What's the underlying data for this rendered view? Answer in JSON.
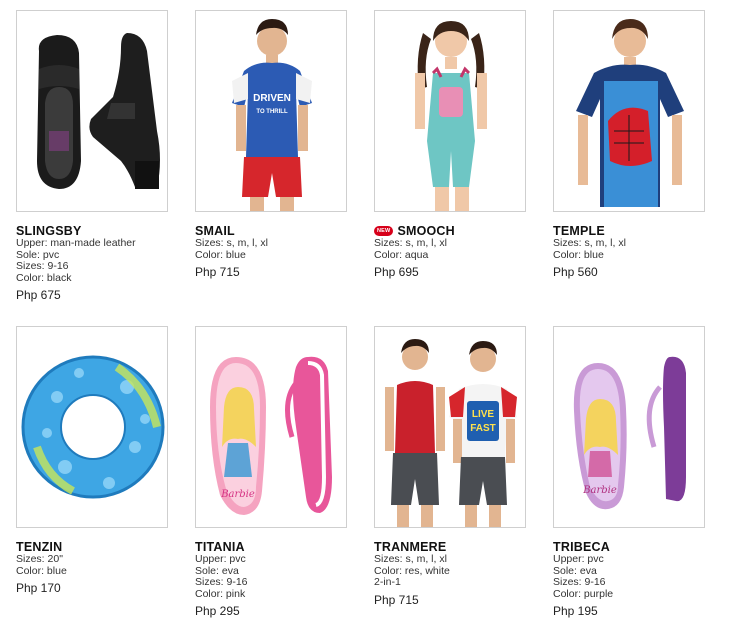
{
  "products": [
    {
      "name": "SLINGSBY",
      "is_new": false,
      "specs": [
        "Upper: man-made leather",
        "Sole: pvc",
        "Sizes: 9-16",
        "Color: black"
      ],
      "price": "Php 675",
      "image": "black-shoes"
    },
    {
      "name": "SMAIL",
      "is_new": false,
      "specs": [
        "Sizes: s, m, l, xl",
        "Color: blue"
      ],
      "price": "Php 715",
      "image": "boy-blue-shirt-red-shorts",
      "print": [
        "DRIVEN",
        "TO THRILL"
      ]
    },
    {
      "name": "SMOOCH",
      "is_new": true,
      "new_label": "NEW",
      "specs": [
        "Sizes: s, m, l, xl",
        "Color: aqua"
      ],
      "price": "Php 695",
      "image": "girl-aqua-romper"
    },
    {
      "name": "TEMPLE",
      "is_new": false,
      "specs": [
        "Sizes: s, m, l, xl",
        "Color: blue"
      ],
      "price": "Php 560",
      "image": "boy-spiderman-shirt"
    },
    {
      "name": "TENZIN",
      "is_new": false,
      "specs": [
        "Sizes: 20\"",
        "Color: blue"
      ],
      "price": "Php 170",
      "image": "blue-swim-ring"
    },
    {
      "name": "TITANIA",
      "is_new": false,
      "specs": [
        "Upper: pvc",
        "Sole: eva",
        "Sizes: 9-16",
        "Color: pink"
      ],
      "price": "Php 295",
      "image": "pink-barbie-flipflops",
      "print": [
        "Barbie"
      ]
    },
    {
      "name": "TRANMERE",
      "is_new": false,
      "specs": [
        "Sizes: s, m, l, xl",
        "Color: res, white",
        "2-in-1"
      ],
      "price": "Php 715",
      "image": "two-boys-tanktop-tee",
      "print": [
        "LIVE",
        "FAST"
      ]
    },
    {
      "name": "TRIBECA",
      "is_new": false,
      "specs": [
        "Upper: pvc",
        "Sole: eva",
        "Sizes: 9-16",
        "Color: purple"
      ],
      "price": "Php 195",
      "image": "purple-barbie-flipflops",
      "print": [
        "Barbie"
      ]
    }
  ],
  "colors": {
    "border": "#cfcfcf",
    "badge": "#d7001a"
  }
}
